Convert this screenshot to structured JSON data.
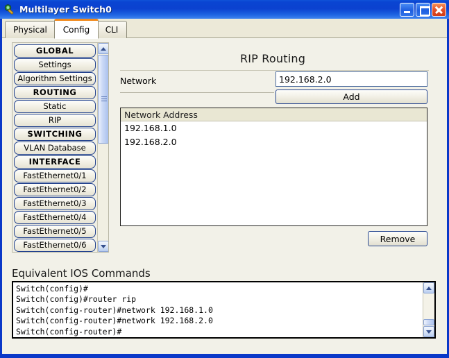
{
  "window": {
    "title": "Multilayer Switch0",
    "icon": "device-icon",
    "buttons": {
      "minimize": "minimize-icon",
      "maximize": "maximize-icon",
      "close": "close-icon"
    },
    "accent_titlebar": "#0b41cf",
    "accent_close": "#e2502a",
    "accent_active_tab": "#f08a1e"
  },
  "tabs": [
    {
      "label": "Physical",
      "active": false
    },
    {
      "label": "Config",
      "active": true
    },
    {
      "label": "CLI",
      "active": false
    }
  ],
  "sidebar": {
    "items": [
      {
        "label": "GLOBAL",
        "section": true
      },
      {
        "label": "Settings",
        "section": false
      },
      {
        "label": "Algorithm Settings",
        "section": false
      },
      {
        "label": "ROUTING",
        "section": true
      },
      {
        "label": "Static",
        "section": false
      },
      {
        "label": "RIP",
        "section": false
      },
      {
        "label": "SWITCHING",
        "section": true
      },
      {
        "label": "VLAN Database",
        "section": false
      },
      {
        "label": "INTERFACE",
        "section": true
      },
      {
        "label": "FastEthernet0/1",
        "section": false
      },
      {
        "label": "FastEthernet0/2",
        "section": false
      },
      {
        "label": "FastEthernet0/3",
        "section": false
      },
      {
        "label": "FastEthernet0/4",
        "section": false
      },
      {
        "label": "FastEthernet0/5",
        "section": false
      },
      {
        "label": "FastEthernet0/6",
        "section": false
      }
    ],
    "scrollbar": {
      "up": "chevron-up-icon",
      "down": "chevron-down-icon"
    }
  },
  "main": {
    "title": "RIP Routing",
    "network_label": "Network",
    "network_value": "192.168.2.0",
    "network_placeholder": "",
    "add_label": "Add",
    "remove_label": "Remove",
    "list": {
      "header": "Network Address",
      "rows": [
        "192.168.1.0",
        "192.168.2.0"
      ]
    }
  },
  "ios": {
    "label": "Equivalent IOS Commands",
    "lines": [
      "Switch(config)#",
      "Switch(config)#router rip",
      "Switch(config-router)#network 192.168.1.0",
      "Switch(config-router)#network 192.168.2.0",
      "Switch(config-router)#"
    ],
    "scrollbar": {
      "up": "chevron-up-icon",
      "down": "chevron-down-icon"
    }
  }
}
